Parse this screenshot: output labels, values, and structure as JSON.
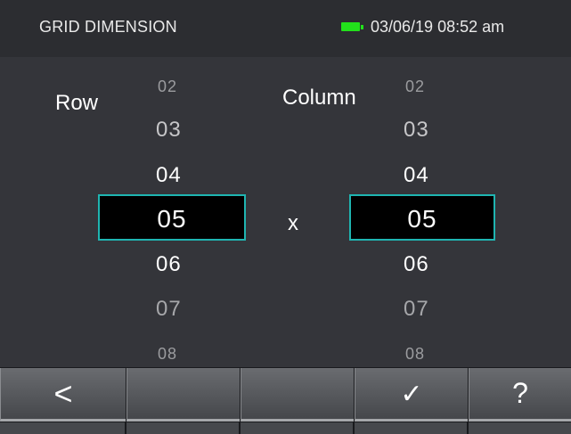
{
  "header": {
    "title": "GRID DIMENSION",
    "datetime": "03/06/19 08:52 am",
    "battery_color": "#22e11b"
  },
  "row_picker": {
    "label": "Row",
    "values_above": [
      "02",
      "03",
      "04"
    ],
    "selected": "05",
    "values_below": [
      "06",
      "07",
      "08"
    ]
  },
  "column_picker": {
    "label": "Column",
    "values_above": [
      "02",
      "03",
      "04"
    ],
    "selected": "05",
    "values_below": [
      "06",
      "07",
      "08"
    ]
  },
  "times_symbol": "x",
  "softkeys": [
    {
      "name": "back",
      "label": "<"
    },
    {
      "name": "empty-2",
      "label": ""
    },
    {
      "name": "empty-3",
      "label": ""
    },
    {
      "name": "confirm",
      "label": "✓"
    },
    {
      "name": "help",
      "label": "?"
    }
  ],
  "accent_color": "#1fb5b1"
}
